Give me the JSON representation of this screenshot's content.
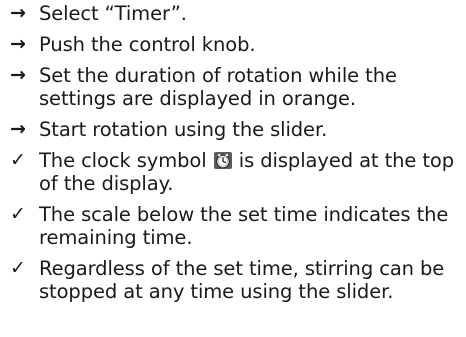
{
  "steps": [
    {
      "bullet": "→",
      "text": "Select “Timer”."
    },
    {
      "bullet": "→",
      "text": "Push the control knob."
    },
    {
      "bullet": "→",
      "text": "Set the duration of rotation while the settings are displayed in orange."
    },
    {
      "bullet": "→",
      "text": "Start rotation using the slider."
    }
  ],
  "results": [
    {
      "bullet": "✓",
      "text_before": "The clock symbol",
      "icon": "clock-icon",
      "text_after": "is displayed at the top of the display."
    },
    {
      "bullet": "✓",
      "text": "The scale below the set time indicates the remaining time."
    },
    {
      "bullet": "✓",
      "text": "Regardless of the set time, stirring can be stopped at any time using the slider."
    }
  ]
}
